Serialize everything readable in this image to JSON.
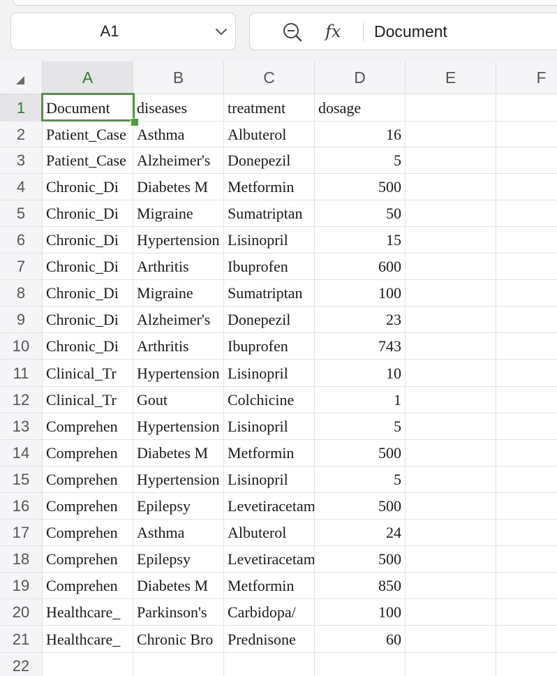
{
  "name_box": {
    "value": "A1"
  },
  "formula_bar": {
    "fx_label": "fx",
    "value": "Document"
  },
  "columns": [
    "A",
    "B",
    "C",
    "D",
    "E",
    "F"
  ],
  "row_numbers": [
    "1",
    "2",
    "3",
    "4",
    "5",
    "6",
    "7",
    "8",
    "9",
    "10",
    "11",
    "12",
    "13",
    "14",
    "15",
    "16",
    "17",
    "18",
    "19",
    "20",
    "21",
    "22"
  ],
  "selected_cell": "A1",
  "accent_color": "#4f9a3c",
  "rows": [
    [
      "Document",
      "diseases",
      "treatment",
      "dosage"
    ],
    [
      "Patient_Case",
      "Asthma",
      "Albuterol",
      "16"
    ],
    [
      "Patient_Case",
      "Alzheimer's",
      "Donepezil",
      "5"
    ],
    [
      "Chronic_Di",
      "Diabetes M",
      "Metformin",
      "500"
    ],
    [
      "Chronic_Di",
      "Migraine",
      "Sumatriptan",
      "50"
    ],
    [
      "Chronic_Di",
      "Hypertension",
      "Lisinopril",
      "15"
    ],
    [
      "Chronic_Di",
      "Arthritis",
      "Ibuprofen",
      "600"
    ],
    [
      "Chronic_Di",
      "Migraine",
      "Sumatriptan",
      "100"
    ],
    [
      "Chronic_Di",
      "Alzheimer's",
      "Donepezil",
      "23"
    ],
    [
      "Chronic_Di",
      "Arthritis",
      "Ibuprofen",
      "743"
    ],
    [
      "Clinical_Tr",
      "Hypertension",
      "Lisinopril",
      "10"
    ],
    [
      "Clinical_Tr",
      "Gout",
      "Colchicine",
      "1"
    ],
    [
      "Comprehen",
      "Hypertension",
      "Lisinopril",
      "5"
    ],
    [
      "Comprehen",
      "Diabetes M",
      "Metformin",
      "500"
    ],
    [
      "Comprehen",
      "Hypertension",
      "Lisinopril",
      "5"
    ],
    [
      "Comprehen",
      "Epilepsy",
      "Levetiracetam",
      "500"
    ],
    [
      "Comprehen",
      "Asthma",
      "Albuterol",
      "24"
    ],
    [
      "Comprehen",
      "Epilepsy",
      "Levetiracetam",
      "500"
    ],
    [
      "Comprehen",
      "Diabetes M",
      "Metformin",
      "850"
    ],
    [
      "Healthcare_",
      "Parkinson's",
      "Carbidopa/",
      "100"
    ],
    [
      "Healthcare_",
      "Chronic Bro",
      "Prednisone",
      "60"
    ]
  ]
}
